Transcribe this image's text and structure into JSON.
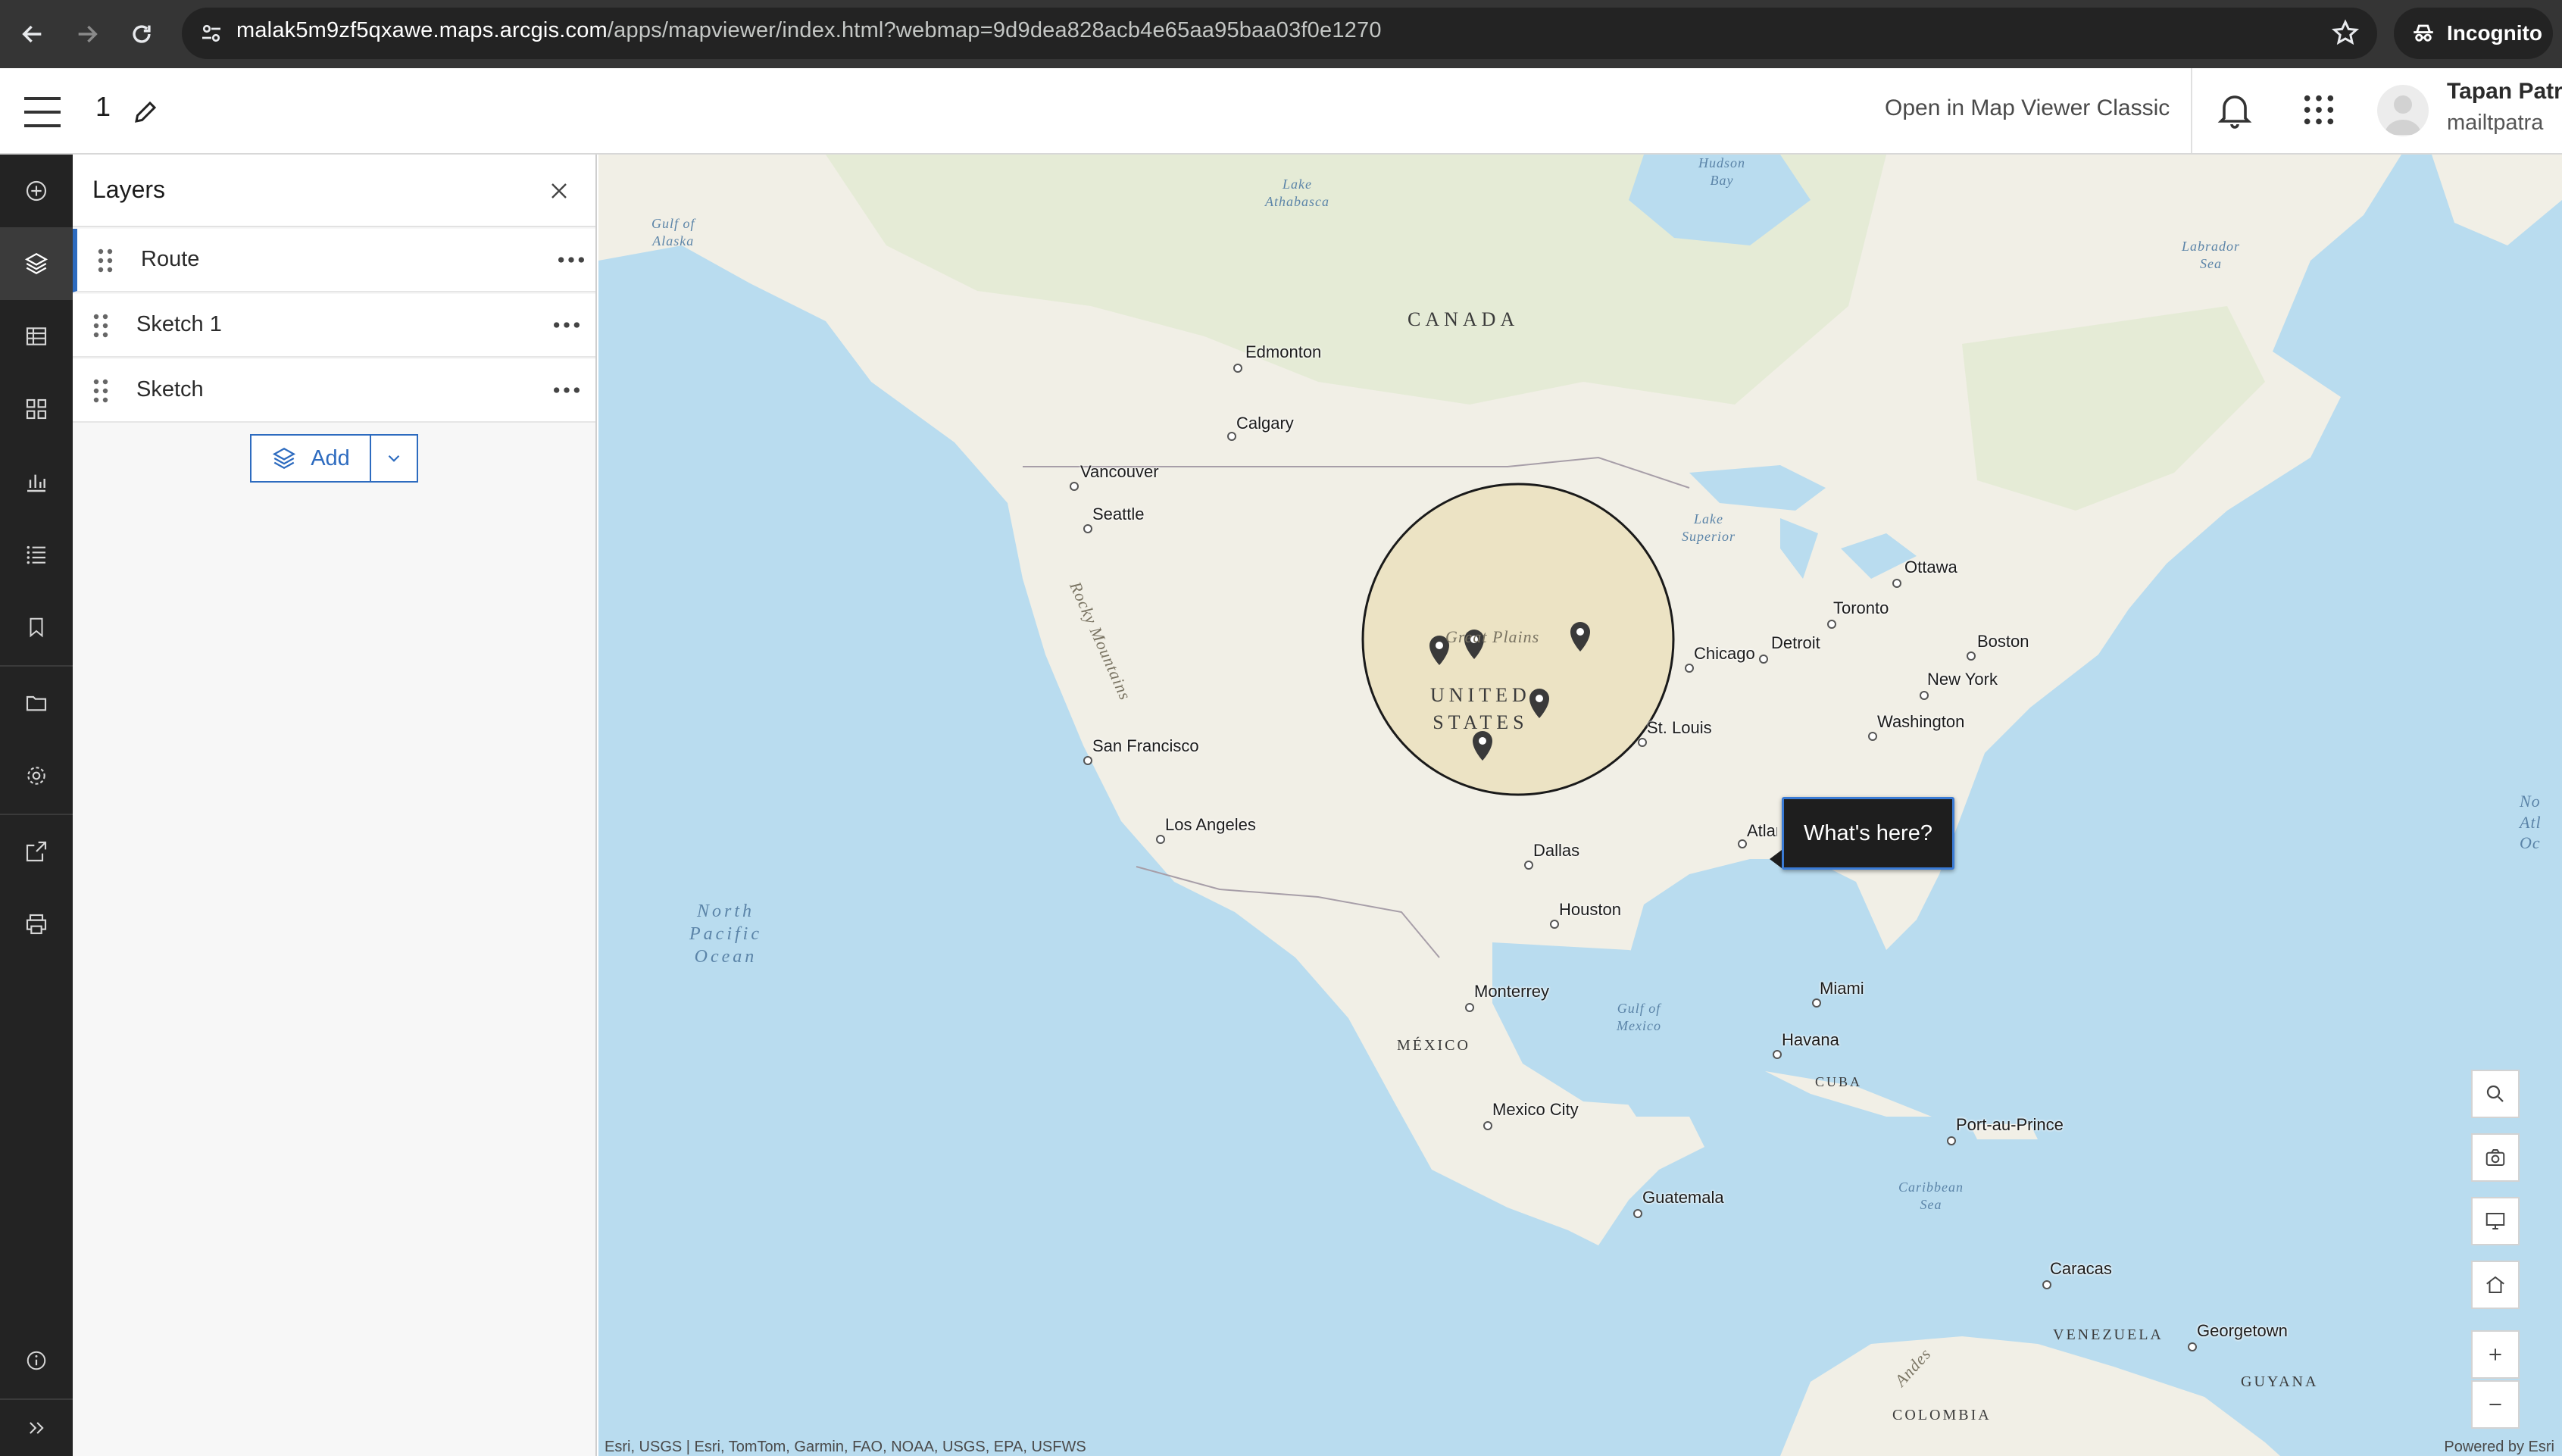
{
  "browser": {
    "url_host": "malak5m9zf5qxawe.maps.arcgis.com",
    "url_path": "/apps/mapviewer/index.html?webmap=9d9dea828acb4e65aa95baa03f0e1270",
    "incognito_label": "Incognito"
  },
  "header": {
    "map_title": "1",
    "open_classic_label": "Open in Map Viewer Classic",
    "user_name": "Tapan Patra",
    "user_handle": "mailtpatra"
  },
  "action_bar": {
    "items": [
      "add-icon",
      "layers-icon",
      "tables-icon",
      "basemap-icon",
      "charts-icon",
      "legend-icon",
      "bookmarks-icon",
      "folder-icon",
      "settings-icon",
      "share-icon",
      "print-icon",
      "info-icon",
      "expand-icon"
    ],
    "active": "layers-icon"
  },
  "layers_panel": {
    "title": "Layers",
    "layers": [
      {
        "label": "Route",
        "selected": true
      },
      {
        "label": "Sketch 1",
        "selected": false
      },
      {
        "label": "Sketch",
        "selected": false
      }
    ],
    "add_label": "Add"
  },
  "map": {
    "countries": {
      "canada": "CANADA",
      "us": "UNITED\nSTATES",
      "mexico": "MÉXICO",
      "cuba": "CUBA",
      "venezuela": "VENEZUELA",
      "guyana": "GUYANA",
      "colombia": "COLOMBIA"
    },
    "regions": {
      "rockies": "Rocky Mountains",
      "great_plains": "Great Plains",
      "andes": "Andes"
    },
    "water": {
      "gulf_alaska": "Gulf of\nAlaska",
      "hudson_bay": "Hudson\nBay",
      "lake_athabasca": "Lake\nAthabasca",
      "labrador_sea": "Labrador\nSea",
      "lake_superior": "Lake\nSuperior",
      "north_pacific": "North\nPacific\nOcean",
      "north_atlantic": "No\nAtl\nOc",
      "gulf_mexico": "Gulf of\nMexico",
      "caribbean_sea": "Caribbean\nSea"
    },
    "cities": [
      "Edmonton",
      "Calgary",
      "Vancouver",
      "Seattle",
      "San Francisco",
      "Los Angeles",
      "Ottawa",
      "Toronto",
      "Detroit",
      "Chicago",
      "Boston",
      "New York",
      "Washington",
      "St. Louis",
      "Atlanta",
      "Dallas",
      "Houston",
      "Miami",
      "Havana",
      "Monterrey",
      "Mexico City",
      "Guatemala",
      "Port-au-Prince",
      "Caracas",
      "Georgetown"
    ],
    "popup_label": "What's here?",
    "attribution": "Esri, USGS | Esri, TomTom, Garmin, FAO, NOAA, USGS, EPA, USFWS",
    "powered_by": "Powered by Esri",
    "colors": {
      "water": "#b9dcef",
      "land": "#f1efe6",
      "buffer_fill": "#e7d9a8",
      "accent": "#2d6bbf"
    }
  }
}
